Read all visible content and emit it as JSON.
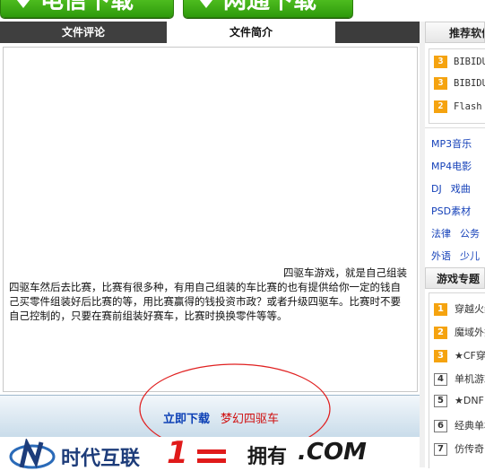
{
  "top_buttons": [
    {
      "label": "电信下载"
    },
    {
      "label": "网通下载"
    }
  ],
  "tabs": [
    {
      "label": "文件评论"
    },
    {
      "label": "文件简介"
    }
  ],
  "description": "四驱车游戏，就是自己组装四驱车然后去比赛，比赛有很多种，有用自己组装的车比赛的也有提供给你一定的钱自己买零件组装好后比赛的等，用比赛赢得的钱投资市政？或者升级四驱车。比赛时不要自己控制的，只要在赛前组装好赛车，比赛时换换零件等等。",
  "download": {
    "link_label": "立即下载",
    "file_name": "梦幻四驱车"
  },
  "banner": {
    "brand": "时代互联",
    "number": "1",
    "slogan": "拥有",
    "domain": ".COM"
  },
  "sidebar": {
    "recommend_title": "推荐软件",
    "recommend": [
      {
        "rank": "3",
        "name": "BIBIDU"
      },
      {
        "rank": "3",
        "name": "BIBIDU"
      },
      {
        "rank": "2",
        "name": "Flash"
      }
    ],
    "categories": [
      [
        "MP3音乐"
      ],
      [
        "MP4电影"
      ],
      [
        "DJ",
        "戏曲"
      ],
      [
        "PSD素材"
      ],
      [
        "法律",
        "公务"
      ],
      [
        "外语",
        "少儿"
      ]
    ],
    "games_title": "游戏专题",
    "games": [
      {
        "rank": "1",
        "name": "穿越火线"
      },
      {
        "rank": "2",
        "name": "魔域外挂"
      },
      {
        "rank": "3",
        "name": "★CF穿越"
      },
      {
        "rank": "4",
        "name": "单机游戏"
      },
      {
        "rank": "5",
        "name": "★DNF"
      },
      {
        "rank": "6",
        "name": "经典单机"
      },
      {
        "rank": "7",
        "name": "仿传奇"
      }
    ]
  }
}
